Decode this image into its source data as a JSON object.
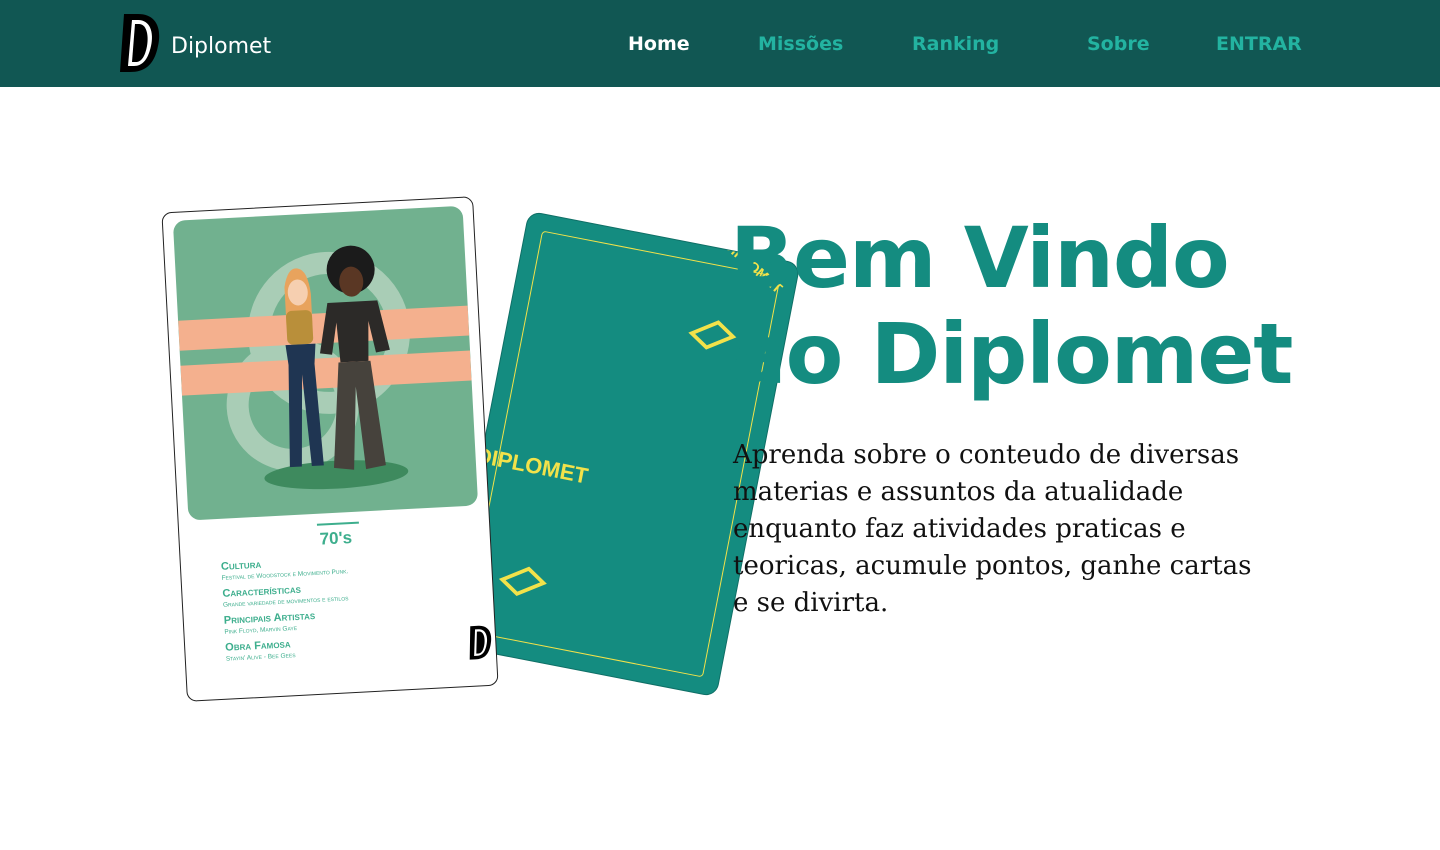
{
  "navbar": {
    "brand": "Diplomet",
    "links": [
      {
        "label": "Home",
        "active": true
      },
      {
        "label": "Missões",
        "active": false
      },
      {
        "label": "Ranking",
        "active": false
      },
      {
        "label": "Sobre",
        "active": false
      },
      {
        "label": "ENTRAR",
        "active": false
      }
    ]
  },
  "card": {
    "back_brand_top": "DIPLOMET",
    "back_brand_mid": "DIPLOMET",
    "era": "70's",
    "items": [
      {
        "title": "Cultura",
        "sub": "Festival de Woodstock e Movimento Punk."
      },
      {
        "title": "Características",
        "sub": "Grande variedade de movimentos e estilos"
      },
      {
        "title": "Principais Artistas",
        "sub": "Pink Floyd, Marvin Gaye"
      },
      {
        "title": "Obra Famosa",
        "sub": "Stayin' Alive - Bee Gees"
      }
    ]
  },
  "hero": {
    "title_line1": "Bem Vindo",
    "title_line2": "ao Diplomet",
    "description": "Aprenda sobre o conteudo de diversas materias e assuntos da atualidade enquanto faz atividades praticas e teoricas,  acumule pontos, ganhe cartas e se divirta."
  },
  "colors": {
    "navbar_bg": "#115753",
    "accent": "#148c80",
    "nav_link": "#23b3a1",
    "card_yellow": "#f2e24a"
  }
}
